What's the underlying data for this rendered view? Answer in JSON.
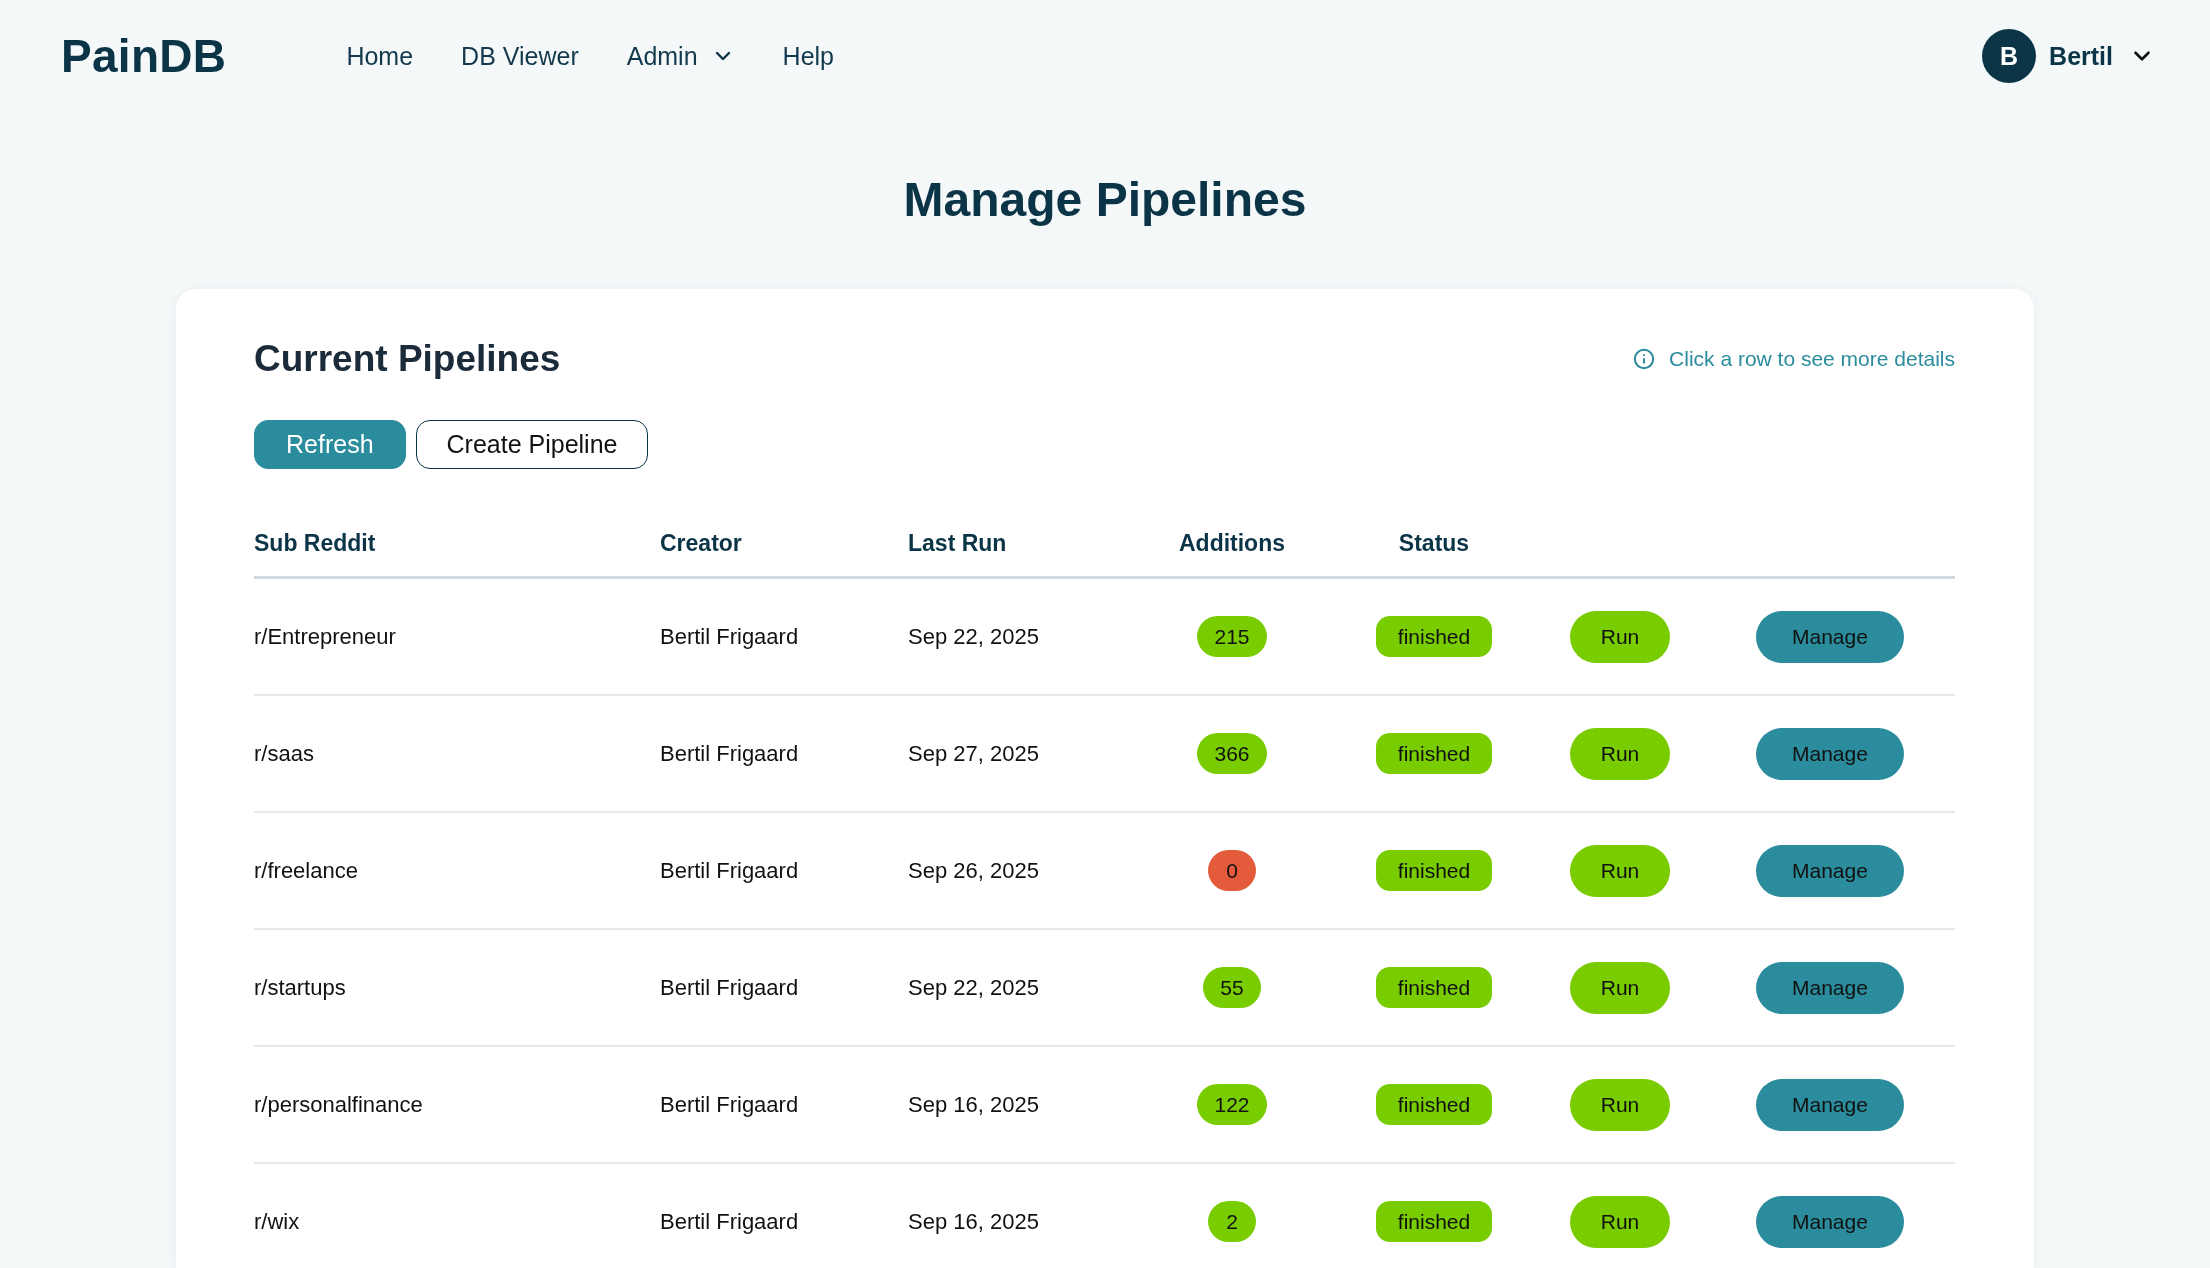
{
  "nav": {
    "logo": "PainDB",
    "links": [
      {
        "label": "Home",
        "kind": "link"
      },
      {
        "label": "DB Viewer",
        "kind": "link"
      },
      {
        "label": "Admin",
        "kind": "dropdown"
      },
      {
        "label": "Help",
        "kind": "link"
      }
    ]
  },
  "user": {
    "initial": "B",
    "name": "Bertil"
  },
  "page_title": "Manage Pipelines",
  "card": {
    "title": "Current Pipelines",
    "hint": "Click a row to see more details",
    "buttons": [
      {
        "label": "Refresh",
        "kind": "primary"
      },
      {
        "label": "Create Pipeline",
        "kind": "outline"
      }
    ]
  },
  "table": {
    "columns": [
      "Sub Reddit",
      "Creator",
      "Last Run",
      "Additions",
      "Status"
    ],
    "rows": [
      {
        "sub_reddit": "r/Entrepreneur",
        "creator": "Bertil Frigaard",
        "last_run": "Sep 22, 2025",
        "additions": {
          "value": "215",
          "color": "#78cc00"
        },
        "status": "finished",
        "actions": [
          {
            "label": "Run",
            "kind": "run"
          },
          {
            "label": "Manage",
            "kind": "manage"
          }
        ]
      },
      {
        "sub_reddit": "r/saas",
        "creator": "Bertil Frigaard",
        "last_run": "Sep 27, 2025",
        "additions": {
          "value": "366",
          "color": "#78cc00"
        },
        "status": "finished",
        "actions": [
          {
            "label": "Run",
            "kind": "run"
          },
          {
            "label": "Manage",
            "kind": "manage"
          }
        ]
      },
      {
        "sub_reddit": "r/freelance",
        "creator": "Bertil Frigaard",
        "last_run": "Sep 26, 2025",
        "additions": {
          "value": "0",
          "color": "#e35b3b"
        },
        "status": "finished",
        "actions": [
          {
            "label": "Run",
            "kind": "run"
          },
          {
            "label": "Manage",
            "kind": "manage"
          }
        ]
      },
      {
        "sub_reddit": "r/startups",
        "creator": "Bertil Frigaard",
        "last_run": "Sep 22, 2025",
        "additions": {
          "value": "55",
          "color": "#78cc00"
        },
        "status": "finished",
        "actions": [
          {
            "label": "Run",
            "kind": "run"
          },
          {
            "label": "Manage",
            "kind": "manage"
          }
        ]
      },
      {
        "sub_reddit": "r/personalfinance",
        "creator": "Bertil Frigaard",
        "last_run": "Sep 16, 2025",
        "additions": {
          "value": "122",
          "color": "#78cc00"
        },
        "status": "finished",
        "actions": [
          {
            "label": "Run",
            "kind": "run"
          },
          {
            "label": "Manage",
            "kind": "manage"
          }
        ]
      },
      {
        "sub_reddit": "r/wix",
        "creator": "Bertil Frigaard",
        "last_run": "Sep 16, 2025",
        "additions": {
          "value": "2",
          "color": "#78cc00"
        },
        "status": "finished",
        "actions": [
          {
            "label": "Run",
            "kind": "run"
          },
          {
            "label": "Manage",
            "kind": "manage"
          }
        ]
      }
    ]
  }
}
